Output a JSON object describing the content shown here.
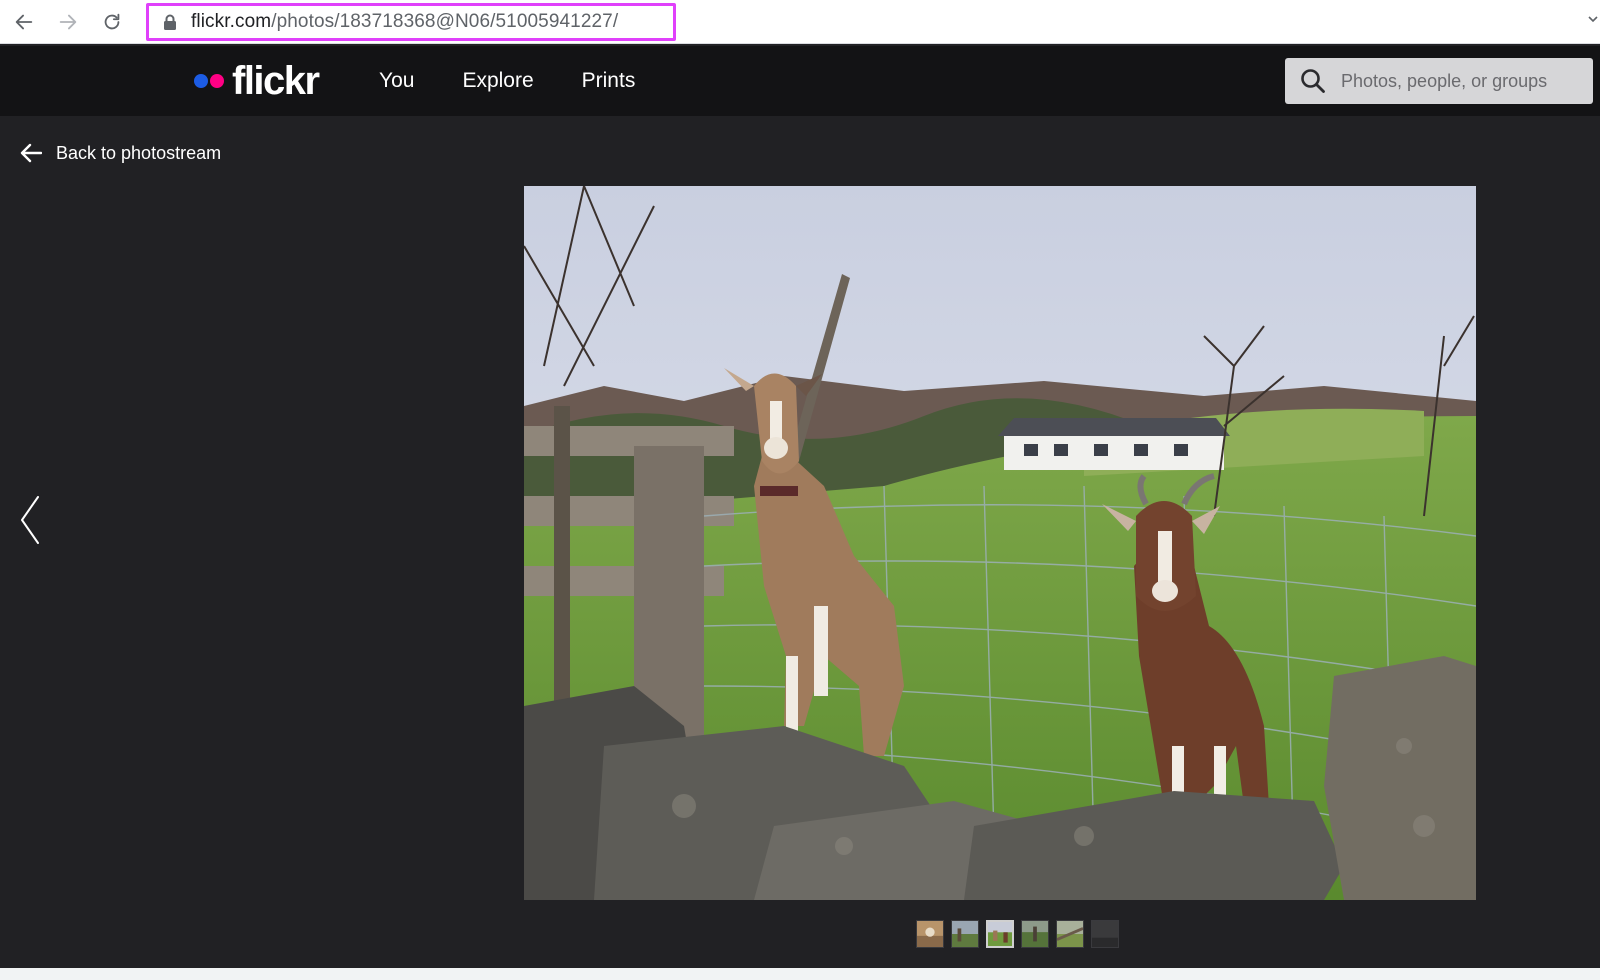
{
  "browser": {
    "url_host": "flickr.com",
    "url_path": "/photos/183718368@N06/51005941227/"
  },
  "header": {
    "logo_text": "flickr",
    "nav": [
      {
        "label": "You"
      },
      {
        "label": "Explore"
      },
      {
        "label": "Prints"
      }
    ],
    "search_placeholder": "Photos, people, or groups"
  },
  "page": {
    "back_label": "Back to photostream"
  },
  "filmstrip": {
    "count": 6,
    "active_index": 2
  },
  "colors": {
    "logo_blue": "#1c5ce4",
    "logo_pink": "#ff0084",
    "header_bg": "#131315",
    "page_bg": "#212124",
    "url_highlight": "#e040fb"
  }
}
